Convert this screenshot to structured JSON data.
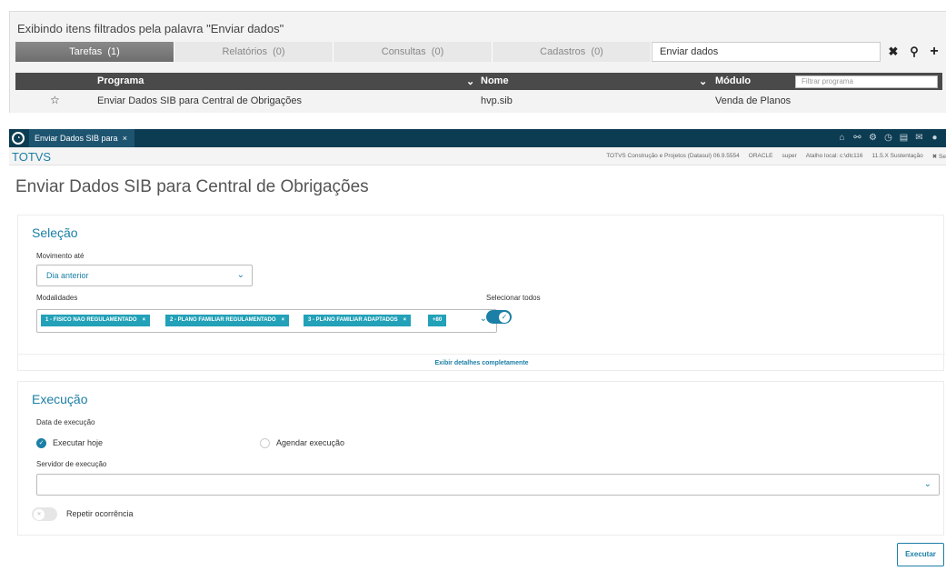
{
  "search": {
    "title": "Exibindo itens filtrados pela palavra \"Enviar dados\"",
    "tabs": [
      {
        "label": "Tarefas",
        "count": "(1)"
      },
      {
        "label": "Relatórios",
        "count": "(0)"
      },
      {
        "label": "Consultas",
        "count": "(0)"
      },
      {
        "label": "Cadastros",
        "count": "(0)"
      }
    ],
    "query": "Enviar dados",
    "filter_placeholder": "Filtrar programa",
    "columns": {
      "program": "Programa",
      "name": "Nome",
      "module": "Módulo"
    },
    "rows": [
      {
        "program": "Enviar Dados SIB para Central de Obrigações",
        "name": "hvp.sib",
        "module": "Venda de Planos"
      }
    ]
  },
  "app_bar": {
    "tab_label": "Enviar Dados SIB para",
    "icons": [
      "home-icon",
      "sitemap-icon",
      "gear-icon",
      "clock-icon",
      "document-icon",
      "mail-icon",
      "circle-icon"
    ]
  },
  "totvs_bar": {
    "brand": "TOTVS",
    "company": "TOTVS Construção e Projetos (Datasul) 06.9.5554",
    "db": "ORACLE",
    "user": "super",
    "shortcut": "Atalho local: c:\\dlc116",
    "version": "11.5.X Sustentação",
    "exit": "✖ Se"
  },
  "page": {
    "title": "Enviar Dados SIB para Central de Obrigações"
  },
  "selecao": {
    "title": "Seleção",
    "movimento_label": "Movimento até",
    "movimento_value": "Dia anterior",
    "modalidades_label": "Modalidades",
    "tags": [
      "1 - FISICO NAO REGULAMENTADO",
      "2 - PLANO FAMILIAR REGULAMENTADO",
      "3 - PLANO FAMILIAR ADAPTADOS",
      "+80"
    ],
    "selecionar_todos_label": "Selecionar todos",
    "selecionar_todos_on": true,
    "details_link": "Exibir detalhes completamente"
  },
  "execucao": {
    "title": "Execução",
    "data_label": "Data de execução",
    "option_today": "Executar hoje",
    "option_schedule": "Agendar execução",
    "selected_option": "Executar hoje",
    "servidor_label": "Servidor de execução",
    "servidor_value": "",
    "repetir_label": "Repetir ocorrência",
    "repetir_on": false
  },
  "actions": {
    "execute": "Executar"
  },
  "colors": {
    "accent": "#1b7fa6",
    "app_bar": "#0c3c52",
    "tag": "#22a1b8"
  }
}
